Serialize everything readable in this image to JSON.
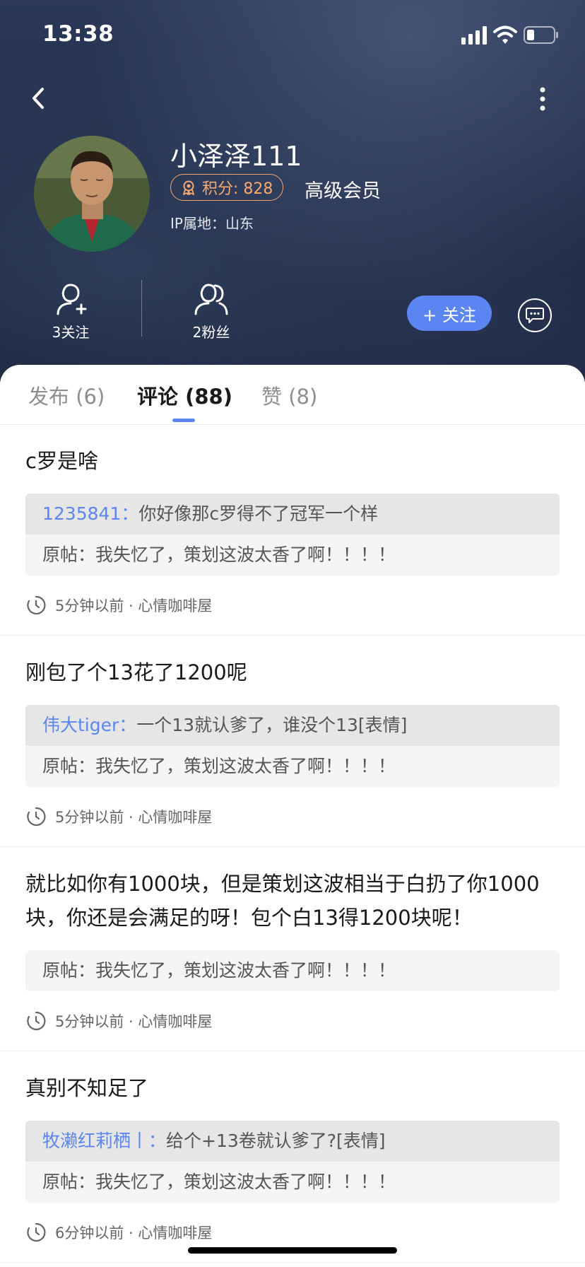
{
  "status_bar": {
    "time": "13:38"
  },
  "profile": {
    "username": "小泽泽111",
    "points": "积分: 828",
    "member_level": "高级会员",
    "ip_location": "IP属地：山东",
    "following": "3关注",
    "fans": "2粉丝",
    "follow_button": "+ 关注"
  },
  "tabs": [
    {
      "label": "发布 (6)"
    },
    {
      "label": "评论 (88)"
    },
    {
      "label": "赞 (8)"
    }
  ],
  "comments": [
    {
      "text": "c罗是啥",
      "reply_user": "1235841：",
      "reply_text": "你好像那c罗得不了冠军一个样",
      "origin": "原帖：我失忆了，策划这波太香了啊！！！！",
      "meta": "5分钟以前 · 心情咖啡屋"
    },
    {
      "text": "刚包了个13花了1200呢",
      "reply_user": "伟大tiger：",
      "reply_text": "一个13就认爹了，谁没个13[表情]",
      "origin": "原帖：我失忆了，策划这波太香了啊！！！！",
      "meta": "5分钟以前 · 心情咖啡屋"
    },
    {
      "text": "就比如你有1000块，但是策划这波相当于白扔了你1000块，你还是会满足的呀！包个白13得1200块呢！",
      "origin": "原帖：我失忆了，策划这波太香了啊！！！！",
      "meta": "5分钟以前 · 心情咖啡屋"
    },
    {
      "text": "真别不知足了",
      "reply_user": "牧濑红莉栖丨：",
      "reply_text": "给个+13卷就认爹了?[表情]",
      "origin": "原帖：我失忆了，策划这波太香了啊！！！！",
      "meta": "6分钟以前 · 心情咖啡屋"
    }
  ],
  "colors": {
    "accent": "#5b85f2",
    "badge": "#f5a36a",
    "header_dark": "#1f2b48"
  },
  "icons": [
    "back-icon",
    "more-icon",
    "follow-user-icon",
    "fans-icon",
    "chat-bubble-icon",
    "medal-icon",
    "clock-icon"
  ]
}
